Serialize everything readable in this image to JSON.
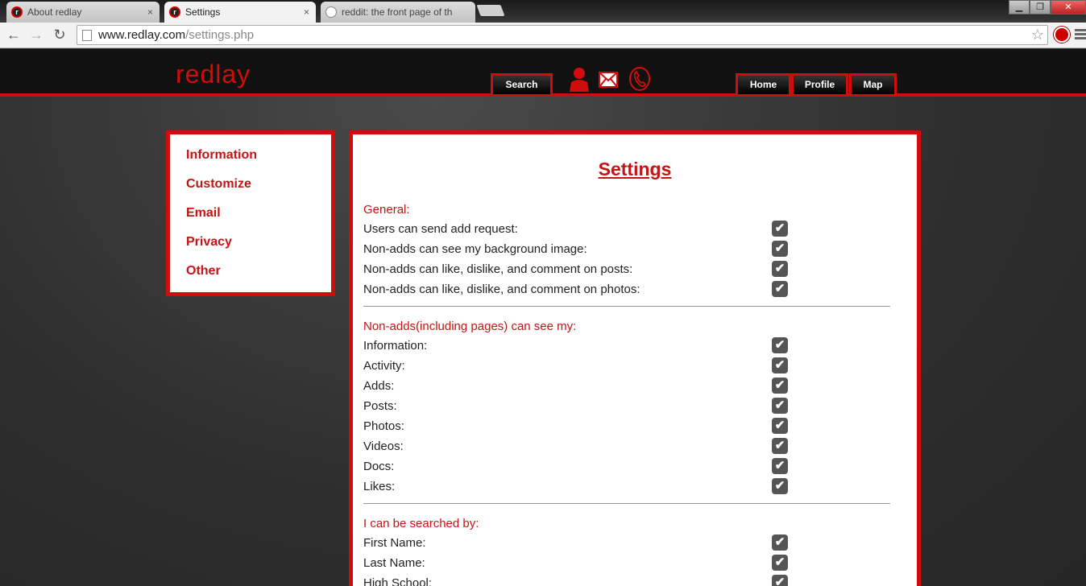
{
  "browser": {
    "tabs": [
      {
        "title": "About redlay",
        "state": "inactive",
        "favicon": "redlay-favicon-icon"
      },
      {
        "title": "Settings",
        "state": "active",
        "favicon": "redlay-favicon-icon"
      },
      {
        "title": "reddit: the front page of th",
        "state": "inactive",
        "favicon": "reddit-alien-icon"
      }
    ],
    "close_glyph": "×",
    "url_host": "www.redlay.com",
    "url_path": "/settings.php",
    "back_glyph": "←",
    "forward_glyph": "→",
    "reload_glyph": "↻",
    "star_glyph": "☆",
    "win_min": "▁",
    "win_max": "❐",
    "win_close": "✕"
  },
  "site": {
    "logo": "redlay",
    "accent_color": "#d10c0c",
    "nav": {
      "search": "Search",
      "home": "Home",
      "profile": "Profile",
      "map": "Map"
    },
    "header_icons": [
      "person-icon",
      "mail-icon",
      "phone-icon"
    ]
  },
  "sidebar": {
    "items": [
      {
        "label": "Information"
      },
      {
        "label": "Customize"
      },
      {
        "label": "Email"
      },
      {
        "label": "Privacy"
      },
      {
        "label": "Other"
      }
    ]
  },
  "settings": {
    "title": "Settings",
    "check_glyph": "✔",
    "sections": [
      {
        "heading": "General:",
        "rows": [
          {
            "label": "Users can send add request:",
            "checked": true
          },
          {
            "label": "Non-adds can see my background image:",
            "checked": true
          },
          {
            "label": "Non-adds can like, dislike, and comment on posts:",
            "checked": true
          },
          {
            "label": "Non-adds can like, dislike, and comment on photos:",
            "checked": true
          }
        ]
      },
      {
        "heading": "Non-adds(including pages) can see my:",
        "rows": [
          {
            "label": "Information:",
            "checked": true
          },
          {
            "label": "Activity:",
            "checked": true
          },
          {
            "label": "Adds:",
            "checked": true
          },
          {
            "label": "Posts:",
            "checked": true
          },
          {
            "label": "Photos:",
            "checked": true
          },
          {
            "label": "Videos:",
            "checked": true
          },
          {
            "label": "Docs:",
            "checked": true
          },
          {
            "label": "Likes:",
            "checked": true
          }
        ]
      },
      {
        "heading": "I can be searched by:",
        "rows": [
          {
            "label": "First Name:",
            "checked": true
          },
          {
            "label": "Last Name:",
            "checked": true
          },
          {
            "label": "High School:",
            "checked": true
          }
        ]
      }
    ]
  }
}
